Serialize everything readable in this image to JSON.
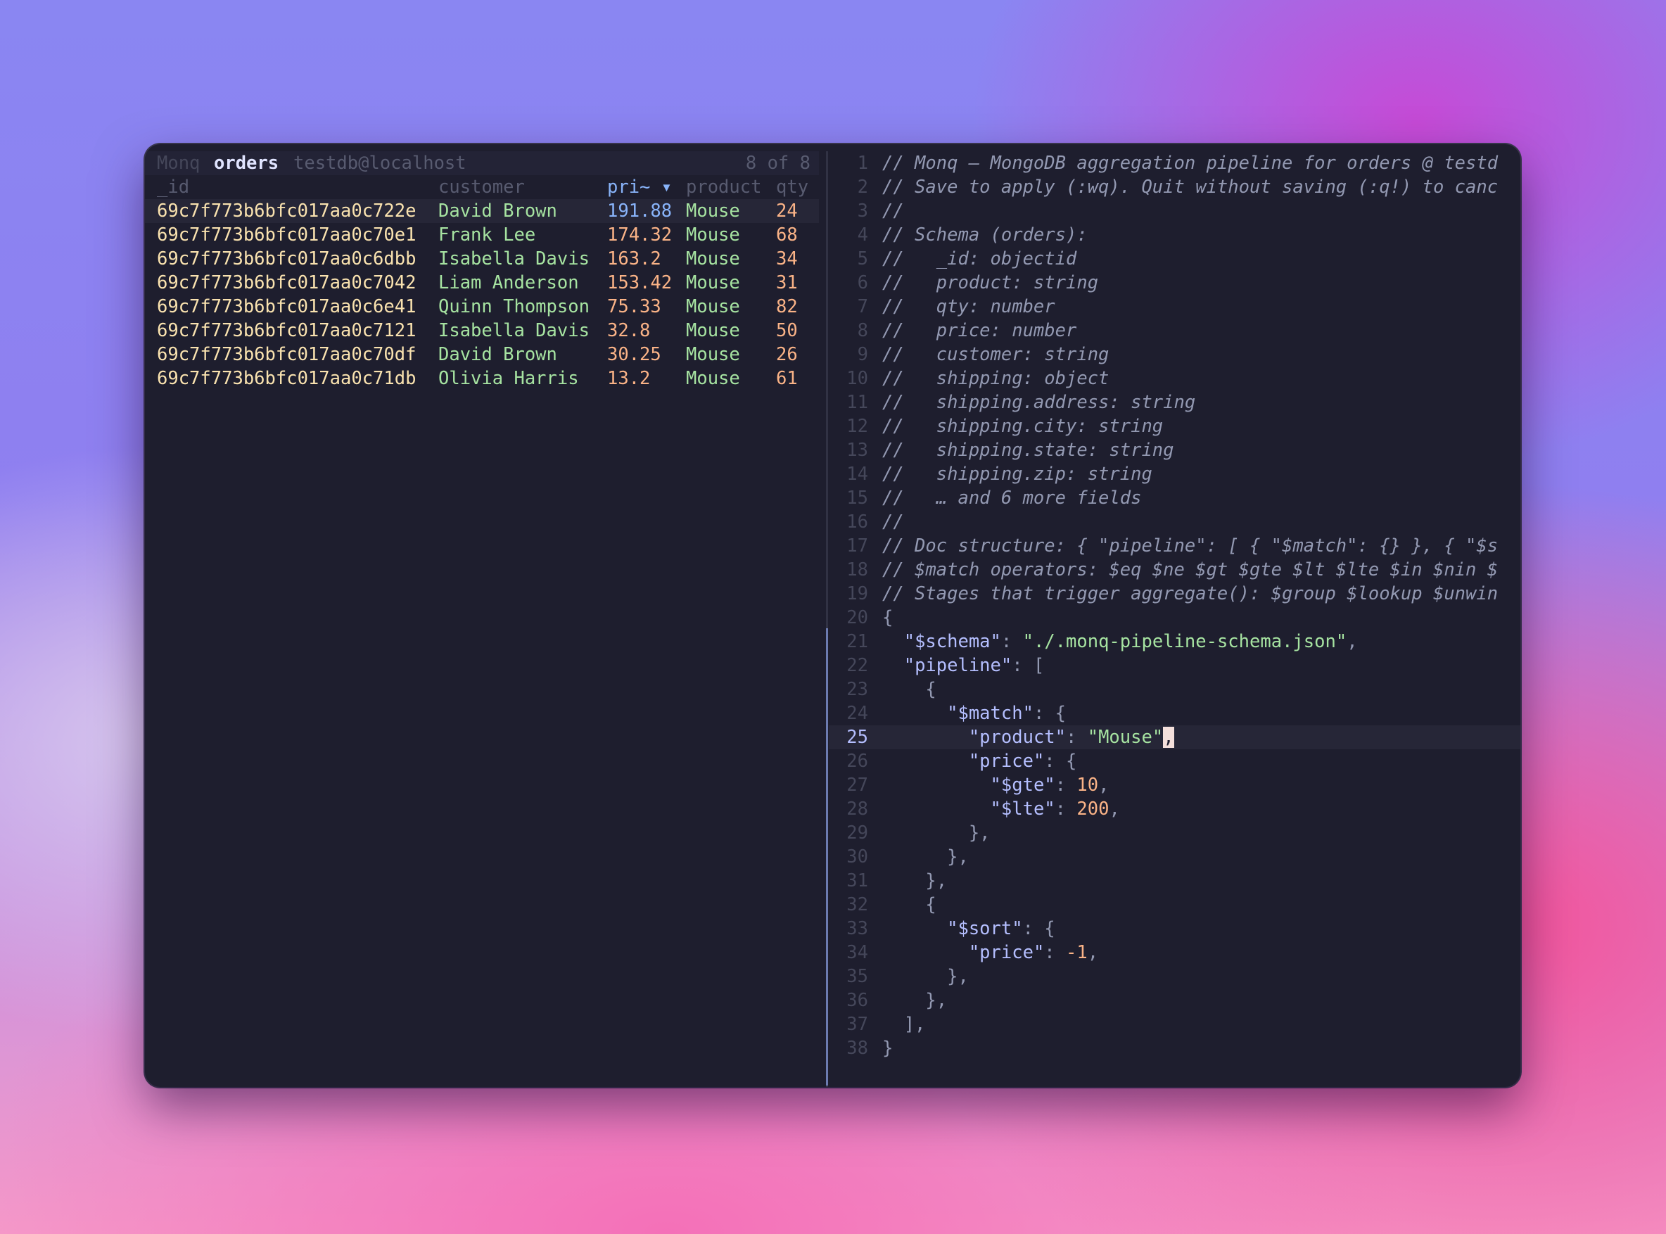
{
  "titlebar": {
    "app": "Monq",
    "collection": "orders",
    "connection": "testdb@localhost",
    "count": "8 of 8"
  },
  "table": {
    "headers": {
      "id": "_id",
      "customer": "customer",
      "price": "pri~ ▾",
      "product": "product",
      "qty": "qty"
    },
    "rows": [
      {
        "id": "69c7f773b6bfc017aa0c722e",
        "customer": "David Brown",
        "price": "191.88",
        "product": "Mouse",
        "qty": "24"
      },
      {
        "id": "69c7f773b6bfc017aa0c70e1",
        "customer": "Frank Lee",
        "price": "174.32",
        "product": "Mouse",
        "qty": "68"
      },
      {
        "id": "69c7f773b6bfc017aa0c6dbb",
        "customer": "Isabella Davis",
        "price": "163.2",
        "product": "Mouse",
        "qty": "34"
      },
      {
        "id": "69c7f773b6bfc017aa0c7042",
        "customer": "Liam Anderson",
        "price": "153.42",
        "product": "Mouse",
        "qty": "31"
      },
      {
        "id": "69c7f773b6bfc017aa0c6e41",
        "customer": "Quinn Thompson",
        "price": "75.33",
        "product": "Mouse",
        "qty": "82"
      },
      {
        "id": "69c7f773b6bfc017aa0c7121",
        "customer": "Isabella Davis",
        "price": "32.8",
        "product": "Mouse",
        "qty": "50"
      },
      {
        "id": "69c7f773b6bfc017aa0c70df",
        "customer": "David Brown",
        "price": "30.25",
        "product": "Mouse",
        "qty": "26"
      },
      {
        "id": "69c7f773b6bfc017aa0c71db",
        "customer": "Olivia Harris",
        "price": "13.2",
        "product": "Mouse",
        "qty": "61"
      }
    ]
  },
  "editor": {
    "current_line": 25,
    "lines": [
      {
        "n": "1",
        "parts": [
          {
            "t": "// Monq — MongoDB aggregation pipeline for orders @ testd",
            "c": "cm"
          }
        ]
      },
      {
        "n": "2",
        "parts": [
          {
            "t": "// Save to apply (:wq). Quit without saving (:q!) to canc",
            "c": "cm"
          }
        ]
      },
      {
        "n": "3",
        "parts": [
          {
            "t": "//",
            "c": "cm"
          }
        ]
      },
      {
        "n": "4",
        "parts": [
          {
            "t": "// Schema (orders):",
            "c": "cm"
          }
        ]
      },
      {
        "n": "5",
        "parts": [
          {
            "t": "//   _id: objectid",
            "c": "cm"
          }
        ]
      },
      {
        "n": "6",
        "parts": [
          {
            "t": "//   product: string",
            "c": "cm"
          }
        ]
      },
      {
        "n": "7",
        "parts": [
          {
            "t": "//   qty: number",
            "c": "cm"
          }
        ]
      },
      {
        "n": "8",
        "parts": [
          {
            "t": "//   price: number",
            "c": "cm"
          }
        ]
      },
      {
        "n": "9",
        "parts": [
          {
            "t": "//   customer: string",
            "c": "cm"
          }
        ]
      },
      {
        "n": "10",
        "parts": [
          {
            "t": "//   shipping: object",
            "c": "cm"
          }
        ]
      },
      {
        "n": "11",
        "parts": [
          {
            "t": "//   shipping.address: string",
            "c": "cm"
          }
        ]
      },
      {
        "n": "12",
        "parts": [
          {
            "t": "//   shipping.city: string",
            "c": "cm"
          }
        ]
      },
      {
        "n": "13",
        "parts": [
          {
            "t": "//   shipping.state: string",
            "c": "cm"
          }
        ]
      },
      {
        "n": "14",
        "parts": [
          {
            "t": "//   shipping.zip: string",
            "c": "cm"
          }
        ]
      },
      {
        "n": "15",
        "parts": [
          {
            "t": "//   … and 6 more fields",
            "c": "cm"
          }
        ]
      },
      {
        "n": "16",
        "parts": [
          {
            "t": "//",
            "c": "cm"
          }
        ]
      },
      {
        "n": "17",
        "parts": [
          {
            "t": "// Doc structure: { \"pipeline\": [ { \"$match\": {} }, { \"$s",
            "c": "cm"
          }
        ]
      },
      {
        "n": "18",
        "parts": [
          {
            "t": "// $match operators: $eq $ne $gt $gte $lt $lte $in $nin $",
            "c": "cm"
          }
        ]
      },
      {
        "n": "19",
        "parts": [
          {
            "t": "// Stages that trigger aggregate(): $group $lookup $unwin",
            "c": "cm"
          }
        ]
      },
      {
        "n": "20",
        "parts": [
          {
            "t": "{",
            "c": "p"
          }
        ]
      },
      {
        "n": "21",
        "parts": [
          {
            "t": "  ",
            "c": "p"
          },
          {
            "t": "\"$schema\"",
            "c": "k"
          },
          {
            "t": ": ",
            "c": "p"
          },
          {
            "t": "\"./.monq-pipeline-schema.json\"",
            "c": "s"
          },
          {
            "t": ",",
            "c": "p"
          }
        ]
      },
      {
        "n": "22",
        "parts": [
          {
            "t": "  ",
            "c": "p"
          },
          {
            "t": "\"pipeline\"",
            "c": "k"
          },
          {
            "t": ": [",
            "c": "p"
          }
        ]
      },
      {
        "n": "23",
        "parts": [
          {
            "t": "    {",
            "c": "p"
          }
        ]
      },
      {
        "n": "24",
        "parts": [
          {
            "t": "      ",
            "c": "p"
          },
          {
            "t": "\"$match\"",
            "c": "k"
          },
          {
            "t": ": {",
            "c": "p"
          }
        ]
      },
      {
        "n": "25",
        "parts": [
          {
            "t": "        ",
            "c": "p"
          },
          {
            "t": "\"product\"",
            "c": "k"
          },
          {
            "t": ": ",
            "c": "p"
          },
          {
            "t": "\"Mouse\"",
            "c": "s"
          },
          {
            "t": ",",
            "c": "cursor"
          }
        ]
      },
      {
        "n": "26",
        "parts": [
          {
            "t": "        ",
            "c": "p"
          },
          {
            "t": "\"price\"",
            "c": "k"
          },
          {
            "t": ": {",
            "c": "p"
          }
        ]
      },
      {
        "n": "27",
        "parts": [
          {
            "t": "          ",
            "c": "p"
          },
          {
            "t": "\"$gte\"",
            "c": "k"
          },
          {
            "t": ": ",
            "c": "p"
          },
          {
            "t": "10",
            "c": "n"
          },
          {
            "t": ",",
            "c": "p"
          }
        ]
      },
      {
        "n": "28",
        "parts": [
          {
            "t": "          ",
            "c": "p"
          },
          {
            "t": "\"$lte\"",
            "c": "k"
          },
          {
            "t": ": ",
            "c": "p"
          },
          {
            "t": "200",
            "c": "n"
          },
          {
            "t": ",",
            "c": "p"
          }
        ]
      },
      {
        "n": "29",
        "parts": [
          {
            "t": "        },",
            "c": "p"
          }
        ]
      },
      {
        "n": "30",
        "parts": [
          {
            "t": "      },",
            "c": "p"
          }
        ]
      },
      {
        "n": "31",
        "parts": [
          {
            "t": "    },",
            "c": "p"
          }
        ]
      },
      {
        "n": "32",
        "parts": [
          {
            "t": "    {",
            "c": "p"
          }
        ]
      },
      {
        "n": "33",
        "parts": [
          {
            "t": "      ",
            "c": "p"
          },
          {
            "t": "\"$sort\"",
            "c": "k"
          },
          {
            "t": ": {",
            "c": "p"
          }
        ]
      },
      {
        "n": "34",
        "parts": [
          {
            "t": "        ",
            "c": "p"
          },
          {
            "t": "\"price\"",
            "c": "k"
          },
          {
            "t": ": ",
            "c": "p"
          },
          {
            "t": "-1",
            "c": "n"
          },
          {
            "t": ",",
            "c": "p"
          }
        ]
      },
      {
        "n": "35",
        "parts": [
          {
            "t": "      },",
            "c": "p"
          }
        ]
      },
      {
        "n": "36",
        "parts": [
          {
            "t": "    },",
            "c": "p"
          }
        ]
      },
      {
        "n": "37",
        "parts": [
          {
            "t": "  ],",
            "c": "p"
          }
        ]
      },
      {
        "n": "38",
        "parts": [
          {
            "t": "}",
            "c": "p"
          }
        ]
      }
    ]
  },
  "colors": {
    "background": "#1e1e2e",
    "id": "#f9e2af",
    "text_green": "#a6e3a1",
    "number_orange": "#fab387",
    "accent_blue": "#89b4fa",
    "key_lavender": "#b4befe",
    "comment": "#9399b2"
  }
}
